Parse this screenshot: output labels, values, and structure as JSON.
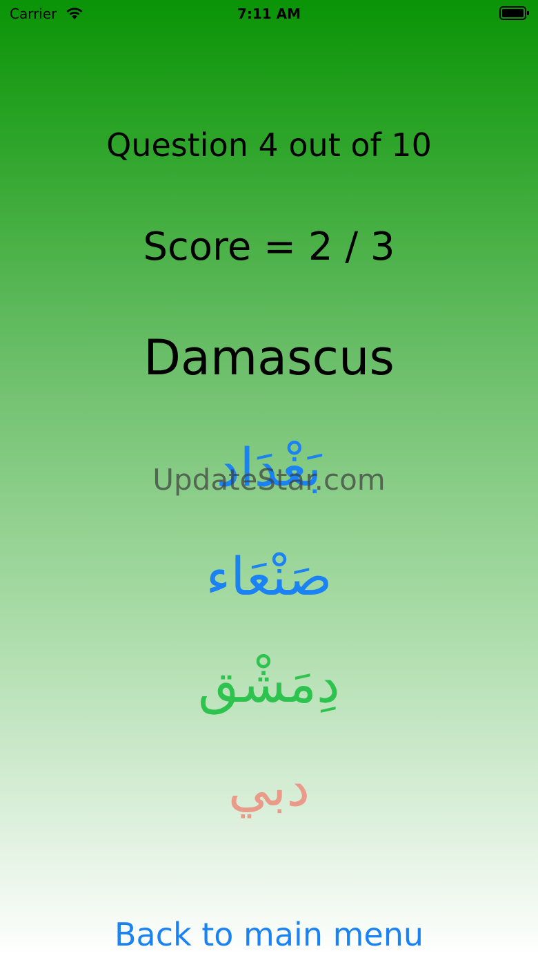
{
  "status_bar": {
    "carrier": "Carrier",
    "time": "7:11 AM",
    "wifi_icon": "wifi-icon",
    "battery_icon": "battery-icon"
  },
  "quiz": {
    "question_progress": "Question 4 out of 10",
    "score": "Score = 2 / 3",
    "city": "Damascus",
    "options": [
      {
        "label": "بَغْدَاد",
        "color": "#1a82f3"
      },
      {
        "label": "صَنْعَاء",
        "color": "#1a82f3"
      },
      {
        "label": "دِمَشْق",
        "color": "#2ec24e"
      },
      {
        "label": "دبي",
        "color": "#e99a88"
      }
    ]
  },
  "watermark": "UpdateStar.com",
  "navigation": {
    "back_label": "Back to main menu"
  },
  "colors": {
    "gradient_top": "#0a9406",
    "gradient_bottom": "#ffffff",
    "link_blue": "#1a82f3",
    "correct_green": "#2ec24e",
    "wrong_salmon": "#e99a88"
  }
}
